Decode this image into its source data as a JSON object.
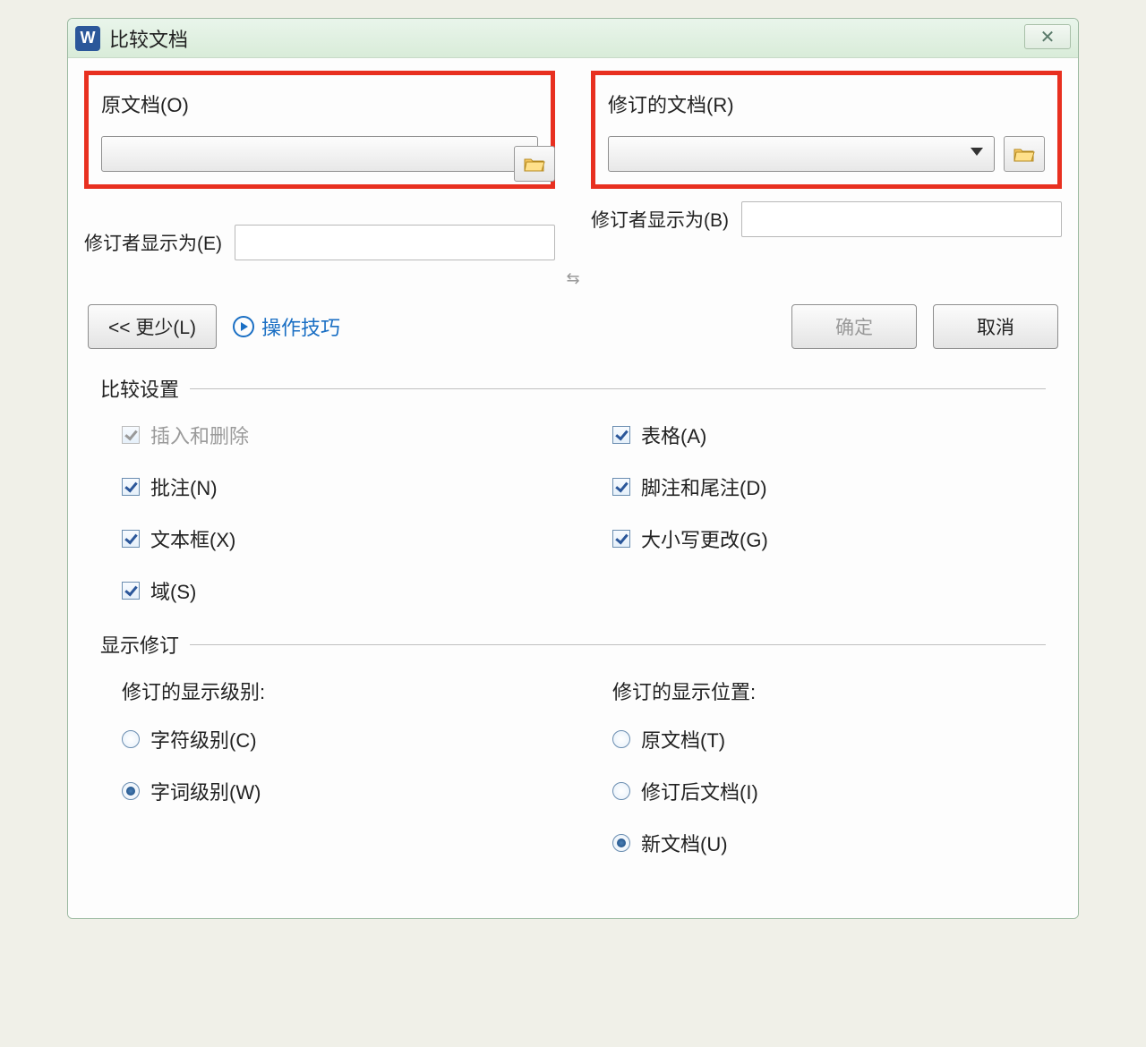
{
  "window": {
    "app_icon_letter": "W",
    "title": "比较文档",
    "close_glyph": "✕"
  },
  "original": {
    "label": "原文档(O)",
    "reviser_label": "修订者显示为(E)",
    "reviser_value": ""
  },
  "revised": {
    "label": "修订的文档(R)",
    "reviser_label": "修订者显示为(B)",
    "reviser_value": ""
  },
  "swap_glyph": "⇆",
  "actions": {
    "less": "<< 更少(L)",
    "tips": "操作技巧",
    "ok": "确定",
    "cancel": "取消"
  },
  "compare_settings": {
    "title": "比较设置",
    "left": {
      "insert_delete": "插入和删除",
      "comments": "批注(N)",
      "textboxes": "文本框(X)",
      "fields": "域(S)"
    },
    "right": {
      "tables": "表格(A)",
      "footnotes": "脚注和尾注(D)",
      "case_changes": "大小写更改(G)"
    }
  },
  "show_revisions": {
    "title": "显示修订",
    "level_label": "修订的显示级别:",
    "level": {
      "char": "字符级别(C)",
      "word": "字词级别(W)"
    },
    "location_label": "修订的显示位置:",
    "location": {
      "original": "原文档(T)",
      "revised": "修订后文档(I)",
      "new_doc": "新文档(U)"
    }
  }
}
